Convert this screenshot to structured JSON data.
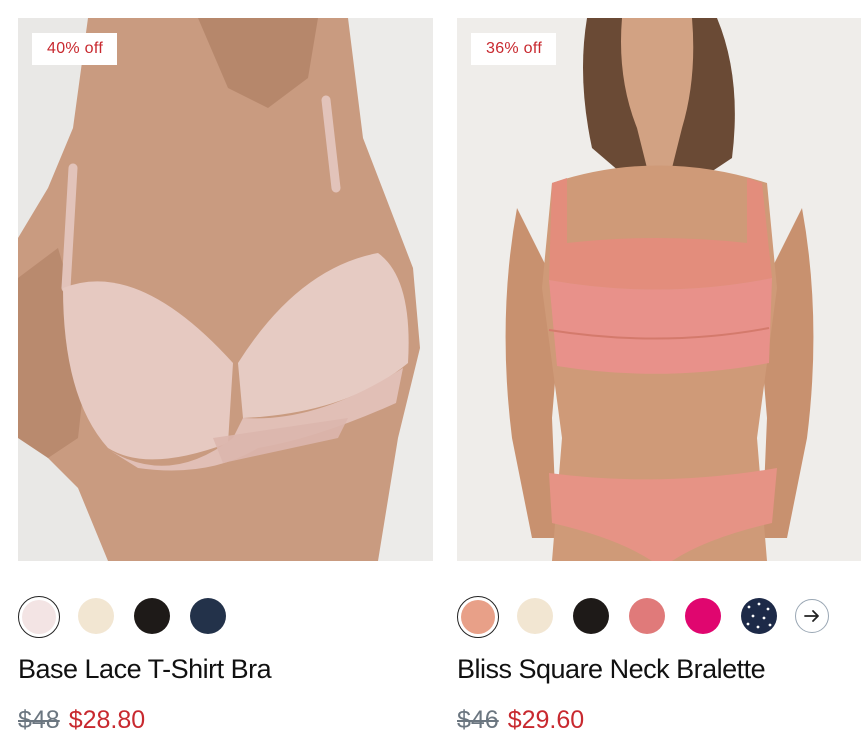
{
  "products": [
    {
      "badge": "40% off",
      "title": "Base Lace T-Shirt Bra",
      "original_price": "$48",
      "sale_price": "$28.80",
      "image_alt": "Model wearing a blush pink lace t-shirt bra",
      "swatches": [
        {
          "name": "blush",
          "color": "#f3e4e4",
          "selected": true
        },
        {
          "name": "ivory",
          "color": "#f2e6d2",
          "selected": false
        },
        {
          "name": "black",
          "color": "#1e1a18",
          "selected": false
        },
        {
          "name": "navy",
          "color": "#23324a",
          "selected": false
        }
      ]
    },
    {
      "badge": "36% off",
      "title": "Bliss Square Neck Bralette",
      "original_price": "$46",
      "sale_price": "$29.60",
      "image_alt": "Model wearing a coral square neck bralette and matching brief",
      "swatches": [
        {
          "name": "coral",
          "color": "#e8a088",
          "selected": true
        },
        {
          "name": "ivory",
          "color": "#f2e6d2",
          "selected": false
        },
        {
          "name": "black",
          "color": "#1e1a18",
          "selected": false
        },
        {
          "name": "rose",
          "color": "#e07a7a",
          "selected": false
        },
        {
          "name": "magenta",
          "color": "#e0066f",
          "selected": false
        },
        {
          "name": "navy-dot",
          "color": "#1d2a48",
          "selected": false
        }
      ],
      "has_more_swatches": true
    }
  ],
  "colors": {
    "sale": "#c8292f",
    "original": "#6b7680"
  }
}
